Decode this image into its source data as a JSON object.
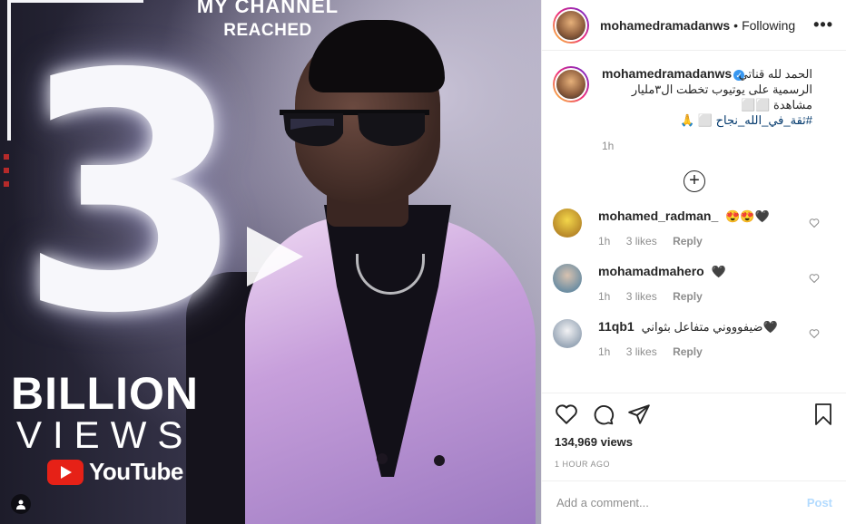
{
  "media": {
    "headline_line1": "MY CHANNEL",
    "headline_line2": "REACHED",
    "big_number": "3",
    "billion": "BILLION",
    "views": "VIEWS",
    "youtube": "YouTube"
  },
  "header": {
    "username": "mohamedramadanws",
    "separator": "•",
    "follow_label": "Following",
    "more": "•••"
  },
  "caption": {
    "username": "mohamedramadanws",
    "line1": "الحمد لله قناتي",
    "line2": "الرسمية على يوتيوب تخطت ال٣مليار مشاهدة ⬜⬜",
    "hashtag": "#ثقة_في_الله_نجاح",
    "line3_suffix": "⬜ 🙏",
    "time": "1h"
  },
  "load_more_icon": "plus-circle-icon",
  "comments": [
    {
      "username": "mohamed_radman_",
      "text": "😍😍🖤",
      "time": "1h",
      "likes": "3 likes",
      "reply": "Reply",
      "avatar_color": "#e9c53a"
    },
    {
      "username": "mohamadmahero",
      "text": "🖤",
      "time": "1h",
      "likes": "3 likes",
      "reply": "Reply",
      "avatar_color": "#8fb7c4"
    },
    {
      "username": "11qb1",
      "text": "ضيفوووني متفاعل بثواني🖤",
      "time": "1h",
      "likes": "3 likes",
      "reply": "Reply",
      "avatar_color": "#c9d3de"
    }
  ],
  "actions": {
    "views": "134,969 views",
    "time_ago": "1 HOUR AGO"
  },
  "add_comment": {
    "placeholder": "Add a comment...",
    "post": "Post"
  },
  "colors": {
    "accent_blue": "#3897f0",
    "post_disabled": "#b3dbff",
    "youtube_red": "#e62117"
  }
}
